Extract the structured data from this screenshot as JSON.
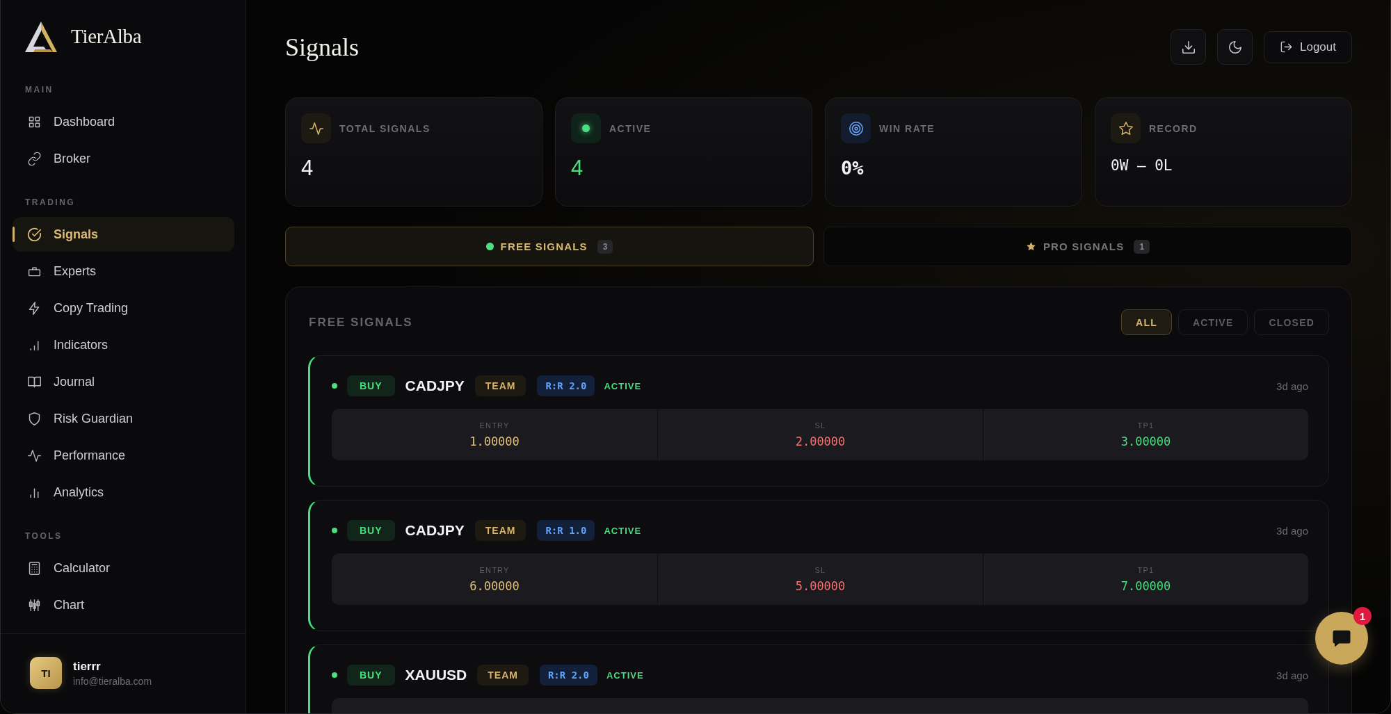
{
  "sidebar": {
    "brand": "TierAlba",
    "sections": [
      {
        "label": "MAIN",
        "items": [
          {
            "label": "Dashboard",
            "selected": false
          },
          {
            "label": "Broker",
            "selected": false
          }
        ]
      },
      {
        "label": "TRADING",
        "items": [
          {
            "label": "Signals",
            "selected": true
          },
          {
            "label": "Experts",
            "selected": false
          },
          {
            "label": "Copy Trading",
            "selected": false
          },
          {
            "label": "Indicators",
            "selected": false
          },
          {
            "label": "Journal",
            "selected": false
          },
          {
            "label": "Risk Guardian",
            "selected": false
          },
          {
            "label": "Performance",
            "selected": false
          },
          {
            "label": "Analytics",
            "selected": false
          }
        ]
      },
      {
        "label": "TOOLS",
        "items": [
          {
            "label": "Calculator",
            "selected": false
          },
          {
            "label": "Chart",
            "selected": false
          }
        ]
      }
    ],
    "user": {
      "initials": "TI",
      "name": "tierrr",
      "email": "info@tieralba.com"
    }
  },
  "header": {
    "title": "Signals",
    "logout_label": "Logout"
  },
  "stats": [
    {
      "kind": "total",
      "label": "TOTAL SIGNALS",
      "value": "4"
    },
    {
      "kind": "active",
      "label": "ACTIVE",
      "value": "4"
    },
    {
      "kind": "rate",
      "label": "WIN RATE",
      "value": "0%"
    },
    {
      "kind": "record",
      "label": "RECORD",
      "value": "0W — 0L"
    }
  ],
  "tabs": [
    {
      "label": "FREE SIGNALS",
      "count": "3",
      "selected": true
    },
    {
      "label": "PRO SIGNALS",
      "count": "1",
      "selected": false
    }
  ],
  "signals_panel": {
    "title": "FREE SIGNALS",
    "filters": [
      {
        "label": "ALL",
        "selected": true
      },
      {
        "label": "ACTIVE",
        "selected": false
      },
      {
        "label": "CLOSED",
        "selected": false
      }
    ],
    "signals": [
      {
        "kind": "active",
        "side": "BUY",
        "symbol": "CADJPY",
        "tag": "TEAM",
        "rr": "R:R 2.0",
        "status": "ACTIVE",
        "time": "3d ago",
        "levels": [
          {
            "kind": "entry",
            "label": "ENTRY",
            "value": "1.00000"
          },
          {
            "kind": "sl",
            "label": "SL",
            "value": "2.00000"
          },
          {
            "kind": "tp",
            "label": "TP1",
            "value": "3.00000"
          }
        ]
      },
      {
        "kind": "active",
        "side": "BUY",
        "symbol": "CADJPY",
        "tag": "TEAM",
        "rr": "R:R 1.0",
        "status": "ACTIVE",
        "time": "3d ago",
        "levels": [
          {
            "kind": "entry",
            "label": "ENTRY",
            "value": "6.00000"
          },
          {
            "kind": "sl",
            "label": "SL",
            "value": "5.00000"
          },
          {
            "kind": "tp",
            "label": "TP1",
            "value": "7.00000"
          }
        ]
      },
      {
        "kind": "active",
        "side": "BUY",
        "symbol": "XAUUSD",
        "tag": "TEAM",
        "rr": "R:R 2.0",
        "status": "ACTIVE",
        "time": "3d ago"
      }
    ]
  },
  "chat": {
    "badge": "1"
  }
}
